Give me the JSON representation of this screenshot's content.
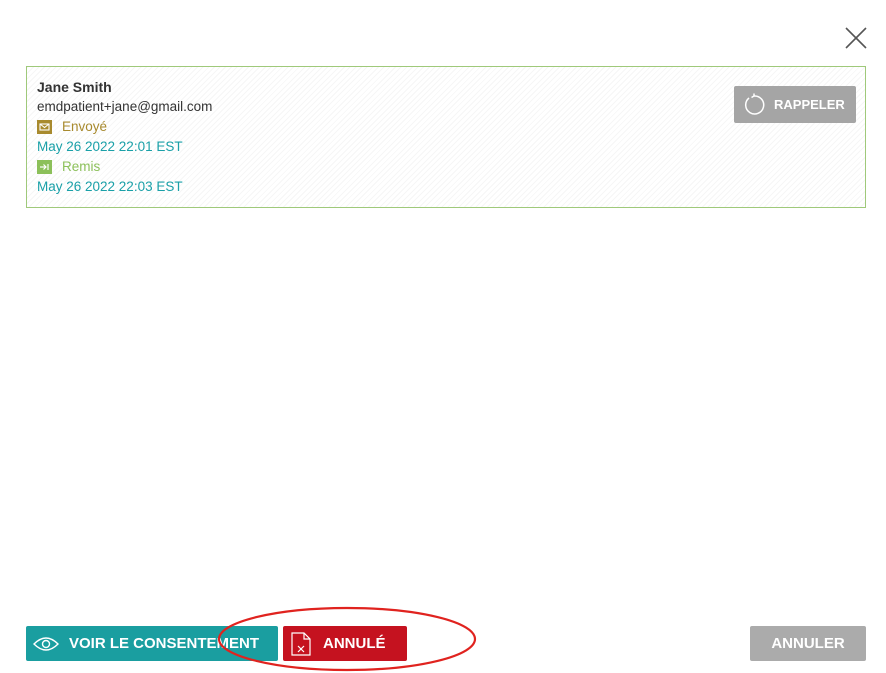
{
  "recipient": {
    "name": "Jane Smith",
    "email": "emdpatient+jane@gmail.com",
    "sent_label": "Envoyé",
    "sent_date": "May 26 2022 22:01 EST",
    "delivered_label": "Remis",
    "delivered_date": "May 26 2022 22:03 EST",
    "recall_label": "RAPPELER"
  },
  "footer": {
    "view_consent_label": "VOIR LE CONSENTEMENT",
    "cancelled_label": "ANNULÉ",
    "cancel_label": "ANNULER"
  },
  "colors": {
    "teal": "#1a9ea0",
    "red": "#c5121f",
    "gray_button": "#ababab",
    "card_border": "#9fc97a",
    "sent": "#a88a2e",
    "delivered": "#8cc05a",
    "annotation": "#e0231f"
  },
  "icons": [
    "close-icon",
    "envelope-icon",
    "delivered-icon",
    "recall-icon",
    "eye-icon",
    "cancelled-document-icon"
  ]
}
